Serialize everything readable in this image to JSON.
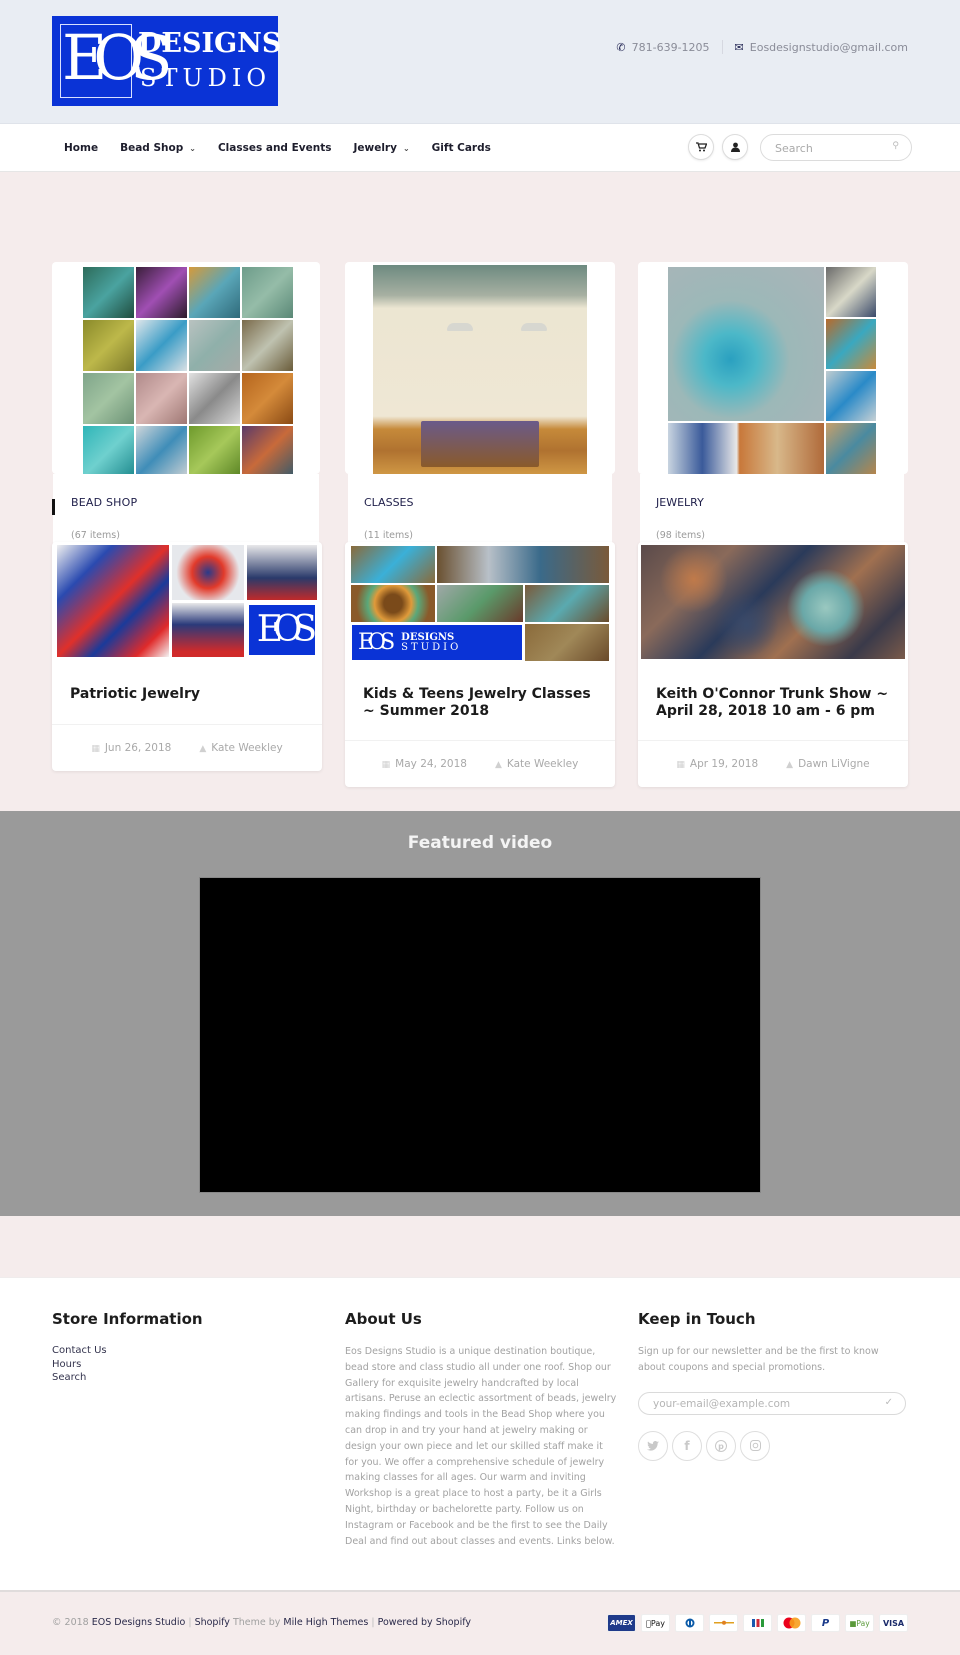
{
  "header": {
    "logo": {
      "monogram": "EOS",
      "line1": "DESIGNS",
      "line2": "STUDIO",
      "bg_color": "#0a33d6"
    },
    "phone": "781-639-1205",
    "email": "Eosdesignstudio@gmail.com",
    "phone_icon": "phone-icon",
    "email_icon": "envelope-icon"
  },
  "nav": {
    "items": [
      {
        "label": "Home",
        "dropdown": false
      },
      {
        "label": "Bead Shop",
        "dropdown": true
      },
      {
        "label": "Classes and Events",
        "dropdown": false
      },
      {
        "label": "Jewelry",
        "dropdown": true
      },
      {
        "label": "Gift Cards",
        "dropdown": false
      }
    ],
    "cart_icon": "cart-icon",
    "account_icon": "user-icon",
    "search_placeholder": "Search",
    "search_icon": "search-icon"
  },
  "collections": [
    {
      "name": "BEAD SHOP",
      "count": "(67 items)"
    },
    {
      "name": "CLASSES",
      "count": "(11 items)"
    },
    {
      "name": "JEWELRY",
      "count": "(98 items)"
    }
  ],
  "blog": [
    {
      "title": "Patriotic Jewelry",
      "date": "Jun 26, 2018",
      "author": "Kate Weekley"
    },
    {
      "title": "Kids & Teens Jewelry Classes ~ Summer 2018",
      "date": "May 24, 2018",
      "author": "Kate Weekley"
    },
    {
      "title": "Keith O'Connor Trunk Show ~ April 28, 2018 10 am - 6 pm",
      "date": "Apr 19, 2018",
      "author": "Dawn LiVigne"
    }
  ],
  "video": {
    "title": "Featured video"
  },
  "footer": {
    "store_info": {
      "heading": "Store Information",
      "links": [
        "Contact Us",
        "Hours",
        "Search"
      ]
    },
    "about": {
      "heading": "About Us",
      "text": "Eos Designs Studio is a unique destination boutique, bead store and class studio all under one roof. Shop our Gallery for exquisite jewelry handcrafted by local artisans. Peruse an eclectic assortment of beads, jewelry making findings and tools in the Bead Shop where you can drop in and try your hand at jewelry making or design your own piece and let our skilled staff make it for you. We offer a comprehensive schedule of jewelry making classes for all ages. Our warm and inviting Workshop is a great place to host a party, be it a Girls Night, birthday or bachelorette party. Follow us on Instagram or Facebook and be the first to see the Daily Deal and find out about classes and events. Links below."
    },
    "newsletter": {
      "heading": "Keep in Touch",
      "text": "Sign up for our newsletter and be the first to know about coupons and special promotions.",
      "placeholder": "your-email@example.com",
      "socials": [
        "twitter",
        "facebook",
        "pinterest",
        "instagram"
      ]
    }
  },
  "bottom": {
    "copyright_prefix": "© 2018",
    "store_name": "EOS Designs Studio",
    "shopify": "Shopify",
    "theme_by": "Theme by",
    "theme_name": "Mile High Themes",
    "powered": "Powered by Shopify",
    "payments": [
      "AMEX",
      "Apple Pay",
      "Diners Club",
      "Discover",
      "JCB",
      "Mastercard",
      "PayPal",
      "Shop Pay",
      "VISA"
    ]
  }
}
